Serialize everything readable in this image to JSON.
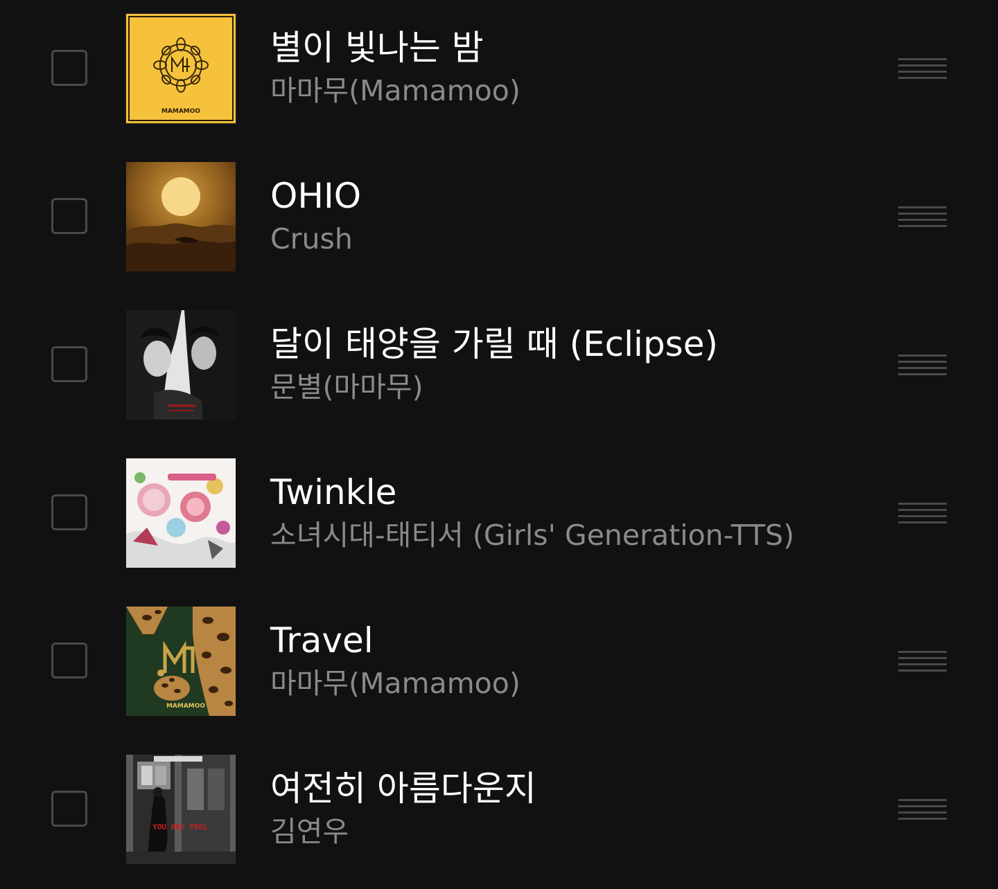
{
  "colors": {
    "background": "#111111",
    "title": "#ffffff",
    "artist": "#8a8a8a",
    "control": "#4a4a4a"
  },
  "tracks": [
    {
      "title": "별이 빛나는 밤",
      "artist": "마마무(Mamamoo)",
      "cover_icon": "mamamoo-yellow-flower-cover",
      "cover_text": "MAMAMOO"
    },
    {
      "title": "OHIO",
      "artist": "Crush",
      "cover_icon": "sun-landscape-cover"
    },
    {
      "title": "달이 태양을 가릴 때 (Eclipse)",
      "artist": "문별(마마무)",
      "cover_icon": "two-portraits-cover"
    },
    {
      "title": "Twinkle",
      "artist": "소녀시대-태티서 (Girls' Generation-TTS)",
      "cover_icon": "colorful-collage-cover"
    },
    {
      "title": "Travel",
      "artist": "마마무(Mamamoo)",
      "cover_icon": "leopard-print-cover",
      "cover_text": "MAMAMOO"
    },
    {
      "title": "여전히 아름다운지",
      "artist": "김연우",
      "cover_icon": "street-photo-cover",
      "cover_text": "YOU HEE YEOL"
    }
  ]
}
